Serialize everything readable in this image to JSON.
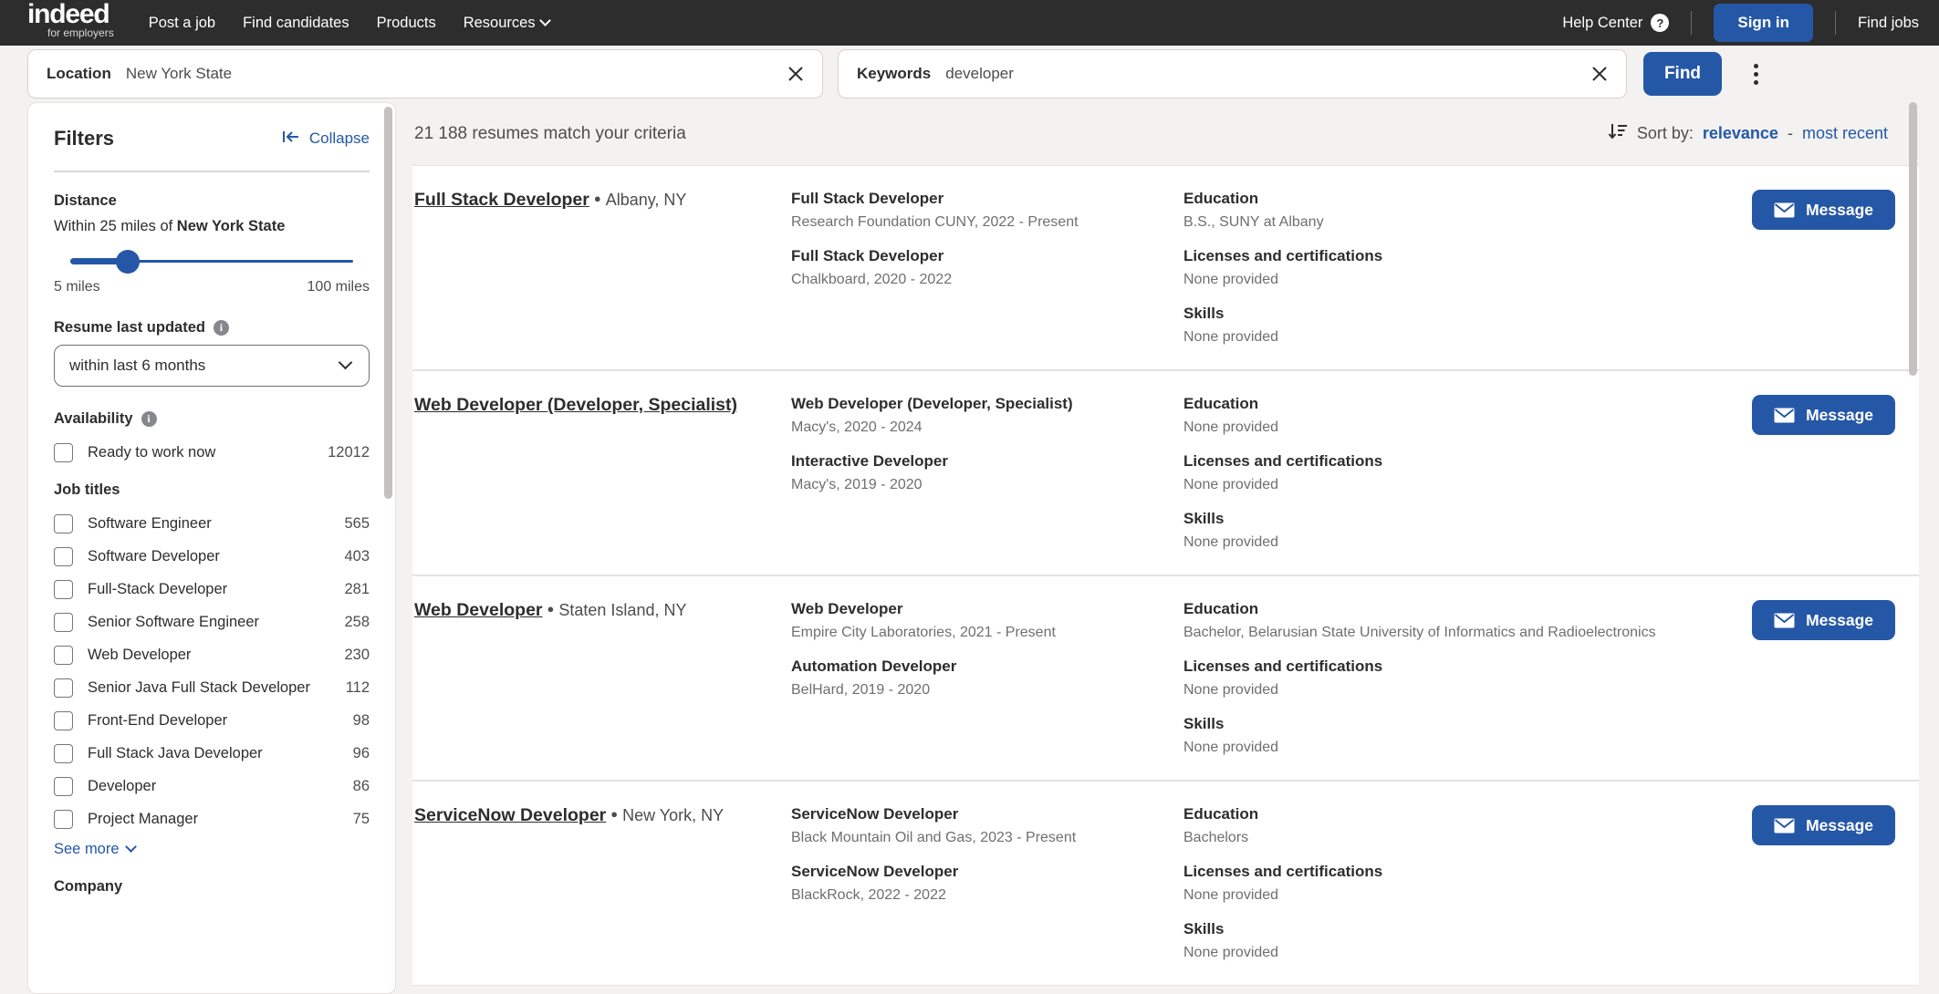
{
  "topnav": {
    "brand_word": "indeed",
    "brand_sub": "for employers",
    "links": [
      {
        "label": "Post a job",
        "has_chevron": false
      },
      {
        "label": "Find candidates",
        "has_chevron": false
      },
      {
        "label": "Products",
        "has_chevron": false
      },
      {
        "label": "Resources",
        "has_chevron": true
      }
    ],
    "help_label": "Help Center",
    "help_icon": "question-mark-icon",
    "signin_label": "Sign in",
    "findjobs_label": "Find jobs"
  },
  "search": {
    "location_label": "Location",
    "location_value": "New York State",
    "location_placeholder": "Location",
    "keywords_label": "Keywords",
    "keywords_value": "developer",
    "keywords_placeholder": "Keywords",
    "clear_icon": "close-x-icon",
    "find_label": "Find",
    "more_icon": "kebab-menu-icon"
  },
  "filters": {
    "title": "Filters",
    "collapse_label": "Collapse",
    "collapse_icon": "collapse-left-icon",
    "distance": {
      "title": "Distance",
      "summary_prefix": "Within 25 miles of ",
      "summary_place": "New York State",
      "min_label": "5 miles",
      "max_label": "100 miles",
      "value_miles": 25
    },
    "resume_updated": {
      "title": "Resume last updated",
      "info_icon": "info-icon",
      "selected": "within last 6 months",
      "chevron_icon": "chevron-down-icon"
    },
    "availability": {
      "title": "Availability",
      "info_icon": "info-icon",
      "options": [
        {
          "label": "Ready to work now",
          "count": "12012"
        }
      ]
    },
    "job_titles": {
      "title": "Job titles",
      "options": [
        {
          "label": "Software Engineer",
          "count": "565"
        },
        {
          "label": "Software Developer",
          "count": "403"
        },
        {
          "label": "Full-Stack Developer",
          "count": "281"
        },
        {
          "label": "Senior Software Engineer",
          "count": "258"
        },
        {
          "label": "Web Developer",
          "count": "230"
        },
        {
          "label": "Senior Java Full Stack Developer",
          "count": "112"
        },
        {
          "label": "Front-End Developer",
          "count": "98"
        },
        {
          "label": "Full Stack Java Developer",
          "count": "96"
        },
        {
          "label": "Developer",
          "count": "86"
        },
        {
          "label": "Project Manager",
          "count": "75"
        }
      ],
      "see_more_label": "See more"
    },
    "company": {
      "title": "Company"
    }
  },
  "results": {
    "count_text": "21 188 resumes match your criteria",
    "sort_icon": "sort-descending-icon",
    "sort_prefix": "Sort by:",
    "sort_relevance": "relevance",
    "sort_dash": "-",
    "sort_recent": "most recent",
    "message_label": "Message",
    "message_icon": "envelope-icon",
    "section_education": "Education",
    "section_licenses": "Licenses and certifications",
    "section_skills": "Skills",
    "cards": [
      {
        "name_title": "Full Stack Developer",
        "location": "Albany, NY",
        "experience": [
          {
            "title": "Full Stack Developer",
            "sub": "Research Foundation CUNY, 2022 - Present"
          },
          {
            "title": "Full Stack Developer",
            "sub": "Chalkboard, 2020 - 2022"
          }
        ],
        "education": "B.S., SUNY at Albany",
        "licenses": "None provided",
        "skills": "None provided"
      },
      {
        "name_title": "Web Developer (Developer, Specialist)",
        "location": "",
        "experience": [
          {
            "title": "Web Developer (Developer, Specialist)",
            "sub": "Macy's, 2020 - 2024"
          },
          {
            "title": "Interactive Developer",
            "sub": "Macy's, 2019 - 2020"
          }
        ],
        "education": "None provided",
        "licenses": "None provided",
        "skills": "None provided"
      },
      {
        "name_title": "Web Developer",
        "location": "Staten Island, NY",
        "experience": [
          {
            "title": "Web Developer",
            "sub": "Empire City Laboratories, 2021 - Present"
          },
          {
            "title": "Automation Developer",
            "sub": "BelHard, 2019 - 2020"
          }
        ],
        "education": "Bachelor, Belarusian State University of Informatics and Radioelectronics",
        "licenses": "None provided",
        "skills": "None provided"
      },
      {
        "name_title": "ServiceNow Developer",
        "location": "New York, NY",
        "experience": [
          {
            "title": "ServiceNow Developer",
            "sub": "Black Mountain Oil and Gas, 2023 - Present"
          },
          {
            "title": "ServiceNow Developer",
            "sub": "BlackRock, 2022 - 2022"
          }
        ],
        "education": "Bachelors",
        "licenses": "None provided",
        "skills": "None provided"
      }
    ]
  },
  "colors": {
    "brand_blue": "#2557a7",
    "nav_dark": "#2d2d2d",
    "page_bg": "#f3f2f1"
  }
}
